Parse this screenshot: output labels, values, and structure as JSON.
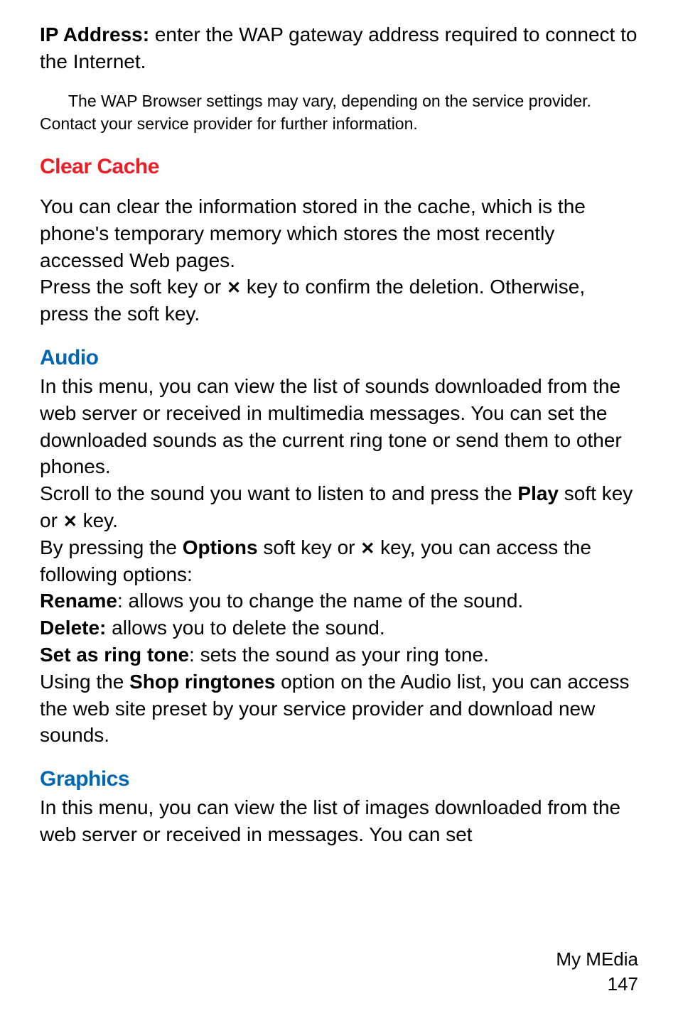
{
  "p1": {
    "label": "IP Address:",
    "text": " enter the WAP gateway address required to connect to the Internet."
  },
  "note": {
    "line1": "The WAP Browser settings may vary, depending on the service provider.",
    "line2": "Contact your service provider for further information."
  },
  "clearCache": {
    "heading": "Clear Cache",
    "p1": "You can clear the information stored in the cache, which is the phone's temporary memory which stores the most recently accessed Web pages.",
    "p2a": "Press the ",
    "p2b": " soft key or ",
    "p2c": " key to confirm the deletion. Otherwise, press the ",
    "p2d": " soft key."
  },
  "audio": {
    "heading": "Audio",
    "p1": "In this menu, you can view the list of sounds downloaded from the web server or received in multimedia messages. You can set the downloaded sounds as the current ring tone or send them to other phones.",
    "p2a": "Scroll to the sound you want to listen to and press the ",
    "p2b": "Play",
    "p2c": " soft key or ",
    "p2d": " key.",
    "p3a": "By pressing the ",
    "p3b": "Options",
    "p3c": " soft key or ",
    "p3d": " key, you can access the following options:",
    "rename": {
      "label": "Rename",
      "text": ": allows you to change the name of the sound."
    },
    "delete": {
      "label": "Delete:",
      "text": " allows you to delete the sound."
    },
    "setring": {
      "label": "Set as ring tone",
      "text": ": sets the sound as your ring tone."
    },
    "p4a": "Using the ",
    "p4b": "Shop ringtones",
    "p4c": " option on the Audio list, you can access the web site preset by your service provider and download new sounds."
  },
  "graphics": {
    "heading": "Graphics",
    "p1": "In this menu, you can view the list of images downloaded from the web server or received in messages. You can set"
  },
  "footer": {
    "section": "My MEdia",
    "page": "147"
  },
  "iconGlyph": "✕"
}
